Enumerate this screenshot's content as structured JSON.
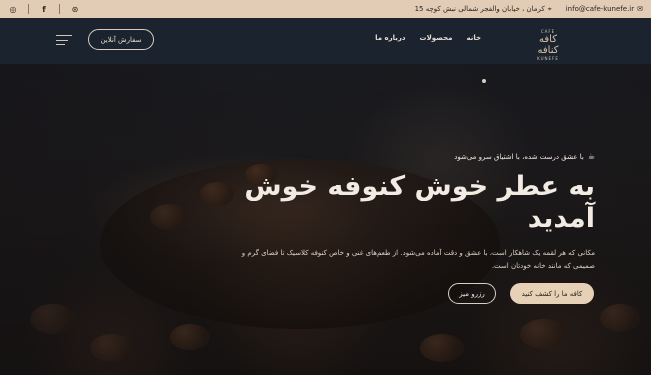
{
  "topbar": {
    "email": "info@cafe-kunefe.ir",
    "address": "کرمان ، خیابان والفجر شمالی نبش کوچه 15",
    "social_icons": [
      "instagram-icon",
      "facebook-icon",
      "dribbble-icon"
    ]
  },
  "header": {
    "logo_top": "CAFE",
    "logo_main": "کافه کنافه",
    "logo_bottom": "KUNEFE",
    "nav": [
      "خانه",
      "محصولات",
      "درباره ما"
    ],
    "order_button": "سفارش آنلاین"
  },
  "hero": {
    "tagline": "با عشق درست شده، با اشتیاق سرو می‌شود",
    "title": "به عطر خوش کنوفه خوش آمدید",
    "description": "مکانی که هر لقمه یک شاهکار است، با عشق و دقت آماده می‌شود. از طعم‌های غنی و خاص کنوفه کلاسیک تا فضای گرم و صمیمی که مانند خانه خودتان است.",
    "primary_button": "کافه ما را کشف کنید",
    "secondary_button": "رزرو میز"
  },
  "colors": {
    "topbar_bg": "#e3ccb5",
    "header_bg": "#1b232f",
    "accent": "#e6d0b6"
  }
}
